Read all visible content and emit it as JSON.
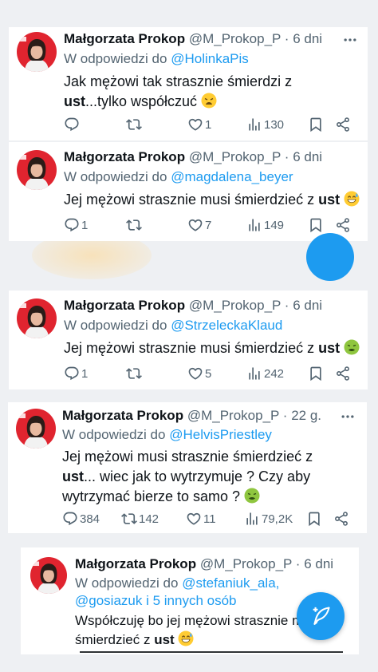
{
  "tweets": [
    {
      "name": "Małgorzata Prokop",
      "handle": "@M_Prokop_P",
      "sep": "·",
      "time": "6 dni",
      "reply_prefix": "W odpowiedzi do",
      "reply_to": "@HolinkaPis",
      "text_before": "Jak mężowi tak strasznie śmierdzi z ",
      "text_bold": "ust",
      "text_after": "...tylko współczuć",
      "emoji": "weary-face",
      "replies": "",
      "retweets": "",
      "likes": "1",
      "views": "130"
    },
    {
      "name": "Małgorzata Prokop",
      "handle": "@M_Prokop_P",
      "sep": "·",
      "time": "6 dni",
      "reply_prefix": "W odpowiedzi do",
      "reply_to": "@magdalena_beyer",
      "text_before": "Jej mężowi strasznie musi śmierdzieć z ",
      "text_bold": "ust",
      "text_after": "",
      "emoji": "grinning-sweat",
      "replies": "1",
      "retweets": "",
      "likes": "7",
      "views": "149"
    },
    {
      "name": "Małgorzata Prokop",
      "handle": "@M_Prokop_P",
      "sep": "·",
      "time": "6 dni",
      "reply_prefix": "W odpowiedzi do",
      "reply_to": "@StrzeleckaKlaud",
      "text_before": "Jej mężowi strasznie musi śmierdzieć z ",
      "text_bold": "ust",
      "text_after": "",
      "emoji": "nauseated-face",
      "replies": "1",
      "retweets": "",
      "likes": "5",
      "views": "242"
    },
    {
      "name": "Małgorzata Prokop",
      "handle": "@M_Prokop_P",
      "sep": "·",
      "time": "22 g.",
      "reply_prefix": "W odpowiedzi do",
      "reply_to": "@HelvisPriestley",
      "text_before": "Jej mężowi musi strasznie śmierdzieć z ",
      "text_bold": "ust",
      "text_after": "... wiec jak to wytrzymuje ? Czy aby wytrzymać bierze to samo ?",
      "emoji": "nauseated-face",
      "replies": "384",
      "retweets": "142",
      "likes": "11",
      "views": "79,2K"
    },
    {
      "name": "Małgorzata Prokop",
      "handle": "@M_Prokop_P",
      "sep": "·",
      "time": "6 dni",
      "reply_prefix": "W odpowiedzi do",
      "reply_to": "@stefaniuk_ala, @gosiazuk i 5 innych osób",
      "text_before": "Współczuję bo jej mężowi strasznie m śmierdzieć z ",
      "text_bold": "ust",
      "text_after": "",
      "emoji": "grinning-sweat"
    }
  ],
  "colors": {
    "accent": "#1d9bf0",
    "secondary_text": "#536471",
    "primary_text": "#0f1419",
    "avatar_red": "#e0242f"
  },
  "icons": {
    "compose": "compose-feather-icon",
    "more": "more-dots-icon",
    "reply": "reply-bubble-icon",
    "retweet": "retweet-icon",
    "like": "heart-icon",
    "views": "views-bar-icon",
    "bookmark": "bookmark-icon",
    "share": "share-icon"
  }
}
